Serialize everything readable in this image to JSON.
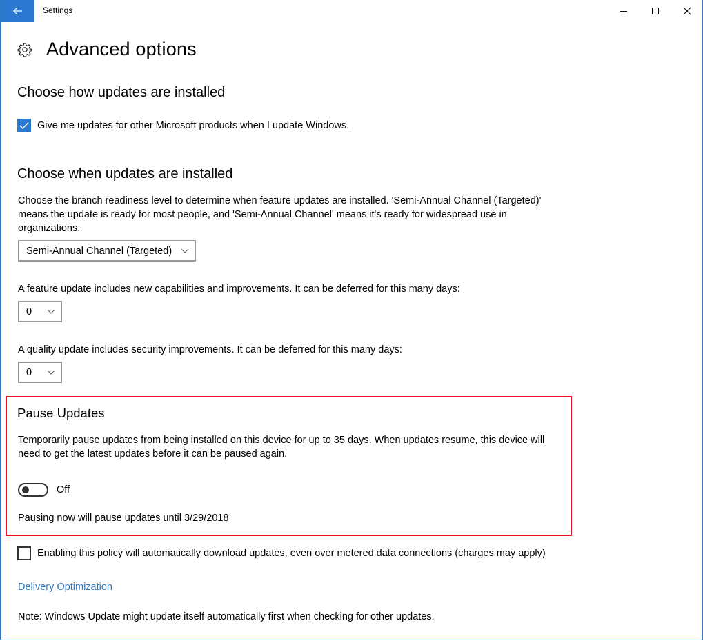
{
  "window": {
    "title": "Settings",
    "controls": {
      "minimize": "minimize-icon",
      "maximize": "maximize-icon",
      "close": "close-icon"
    },
    "accent_color": "#2b79d0"
  },
  "page": {
    "icon": "gear-icon",
    "title": "Advanced options"
  },
  "how_section": {
    "title": "Choose how updates are installed",
    "checkbox": {
      "label": "Give me updates for other Microsoft products when I update Windows.",
      "checked": true
    }
  },
  "when_section": {
    "title": "Choose when updates are installed",
    "description": "Choose the branch readiness level to determine when feature updates are installed. 'Semi-Annual Channel (Targeted)' means the update is ready for most people, and 'Semi-Annual Channel' means it's ready for widespread use in organizations.",
    "branch_dropdown": {
      "selected": "Semi-Annual Channel (Targeted)"
    },
    "feature_label": "A feature update includes new capabilities and improvements. It can be deferred for this many days:",
    "feature_dropdown": {
      "selected": "0"
    },
    "quality_label": "A quality update includes security improvements. It can be deferred for this many days:",
    "quality_dropdown": {
      "selected": "0"
    }
  },
  "pause_section": {
    "title": "Pause Updates",
    "description": "Temporarily pause updates from being installed on this device for up to 35 days. When updates resume, this device will need to get the latest updates before it can be paused again.",
    "toggle": {
      "state": "Off",
      "on": false
    },
    "note": "Pausing now will pause updates until 3/29/2018",
    "highlight_color": "#e81123"
  },
  "metered": {
    "label": "Enabling this policy will automatically download updates, even over metered data connections (charges may apply)",
    "checked": false
  },
  "delivery_link": "Delivery Optimization",
  "footer_note": "Note: Windows Update might update itself automatically first when checking for other updates."
}
